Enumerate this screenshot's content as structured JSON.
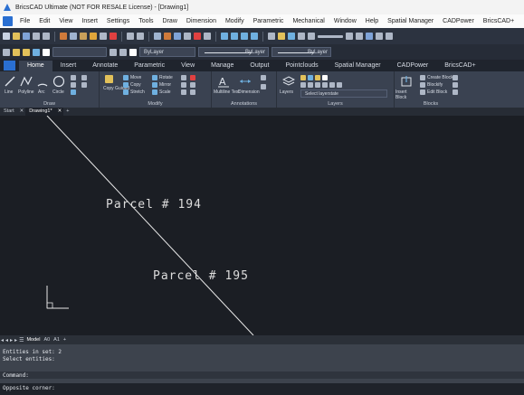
{
  "window": {
    "title": "BricsCAD Ultimate (NOT FOR RESALE License) - [Drawing1]"
  },
  "menu": [
    "File",
    "Edit",
    "View",
    "Insert",
    "Settings",
    "Tools",
    "Draw",
    "Dimension",
    "Modify",
    "Parametric",
    "Mechanical",
    "Window",
    "Help",
    "Spatial Manager",
    "CADPower",
    "BricsCAD+"
  ],
  "toolbar": {
    "layer_name": "ByLayer",
    "linetype_label": "ByLayer",
    "lineweight_label": "ByLayer"
  },
  "ribbon_tabs": [
    {
      "label": "Home",
      "active": true
    },
    {
      "label": "Insert",
      "active": false
    },
    {
      "label": "Annotate",
      "active": false
    },
    {
      "label": "Parametric",
      "active": false
    },
    {
      "label": "View",
      "active": false
    },
    {
      "label": "Manage",
      "active": false
    },
    {
      "label": "Output",
      "active": false
    },
    {
      "label": "Pointclouds",
      "active": false
    },
    {
      "label": "Spatial Manager",
      "active": false
    },
    {
      "label": "CADPower",
      "active": false
    },
    {
      "label": "BricsCAD+",
      "active": false
    }
  ],
  "ribbon": {
    "draw": {
      "title": "Draw",
      "line": "Line",
      "polyline": "Polyline",
      "arc": "Arc",
      "circle": "Circle"
    },
    "modify": {
      "title": "Modify",
      "move": "Move",
      "rotate": "Rotate",
      "copy": "Copy",
      "mirror": "Mirror",
      "stretch": "Stretch",
      "scale": "Scale",
      "copy_guided": "Copy Guided"
    },
    "annotations": {
      "title": "Annotations",
      "mtext": "Multiline Text",
      "dimension": "Dimension"
    },
    "layers": {
      "title": "Layers",
      "layers_btn": "Layers",
      "select_layerstate": "Select layerstate"
    },
    "blocks": {
      "title": "Blocks",
      "insert": "Insert Block",
      "create_block": "Create Block",
      "blockify": "Blockify",
      "edit_block": "Edit Block"
    }
  },
  "doc_tabs": [
    {
      "label": "Start",
      "active": false
    },
    {
      "label": "Drawing1*",
      "active": true
    }
  ],
  "drawing": {
    "labels": [
      "Parcel # 194",
      "Parcel # 195"
    ]
  },
  "layout_tabs": {
    "model": "Model",
    "layouts": [
      "A0",
      "A1"
    ]
  },
  "command": {
    "lines": [
      "Entities in set: 2",
      "Select entities:"
    ],
    "prompt": "Command:",
    "status": "Opposite corner:"
  },
  "colors": {
    "background": "#1b1e24",
    "ribbon": "#3a4251",
    "accent": "#2a6fd1",
    "label_text": "#dcdcdc"
  }
}
